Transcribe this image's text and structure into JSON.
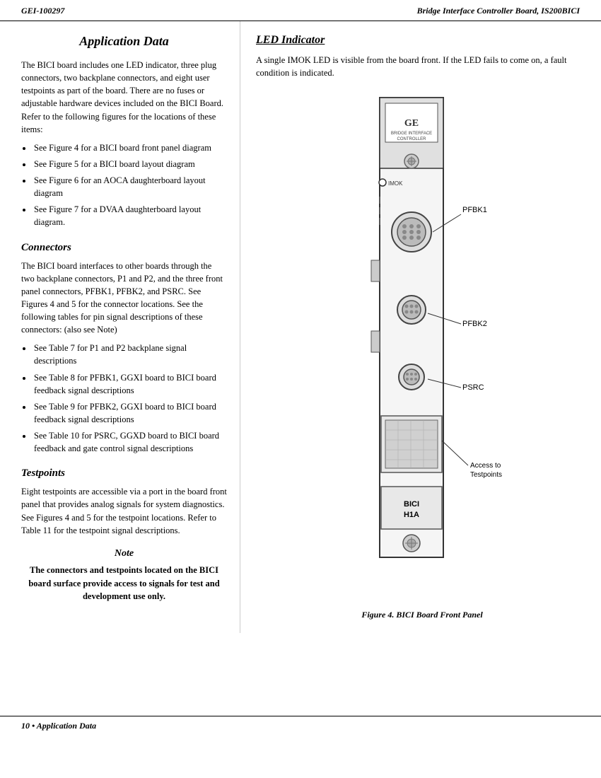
{
  "header": {
    "left": "GEI-100297",
    "right": "Bridge Interface Controller Board, IS200BICI"
  },
  "footer": {
    "text": "10 • Application Data"
  },
  "left_column": {
    "page_title": "Application Data",
    "intro_text": "The BICI board includes one LED indicator, three plug connectors, two backplane connectors, and eight user testpoints as part of the board. There are no fuses or adjustable hardware devices included on the BICI Board. Refer to the following figures for the locations of these items:",
    "intro_bullets": [
      "See Figure 4 for a BICI board front panel diagram",
      "See Figure 5 for a BICI board layout diagram",
      "See Figure 6 for an AOCA daughterboard layout diagram",
      "See Figure 7 for a DVAA daughterboard layout diagram."
    ],
    "connectors_heading": "Connectors",
    "connectors_text": "The BICI board interfaces to other boards through the two backplane connectors, P1 and P2, and the three front panel connectors, PFBK1, PFBK2, and PSRC. See Figures 4 and 5 for the connector locations. See the following tables for pin signal descriptions of these connectors: (also see Note)",
    "connectors_bullets": [
      "See Table 7 for P1 and P2 backplane signal descriptions",
      "See Table 8 for PFBK1, GGXI board to BICI board feedback signal descriptions",
      "See Table 9 for PFBK2, GGXI board to BICI board feedback signal descriptions",
      "See Table 10 for PSRC, GGXD board to BICI board feedback and gate control signal descriptions"
    ],
    "testpoints_heading": "Testpoints",
    "testpoints_text": "Eight testpoints are accessible via a port in the board front panel that provides analog signals for system diagnostics. See Figures 4 and 5 for the testpoint locations. Refer to Table 11 for the testpoint signal descriptions.",
    "note_heading": "Note",
    "note_text": "The connectors and testpoints located on the BICI board surface provide access to signals for test and development use only."
  },
  "right_column": {
    "led_heading": "LED Indicator",
    "led_text": "A single IMOK LED is visible from the board front. If the LED fails to come on, a fault condition is indicated.",
    "figure_caption": "Figure 4.  BICI Board Front Panel",
    "labels": {
      "pfbk1": "PFBK1",
      "pfbk2": "PFBK2",
      "psrc": "PSRC",
      "access": "Access to Testpoints",
      "bici": "BICI",
      "h1a": "H1A",
      "imok": "IMOK"
    }
  }
}
